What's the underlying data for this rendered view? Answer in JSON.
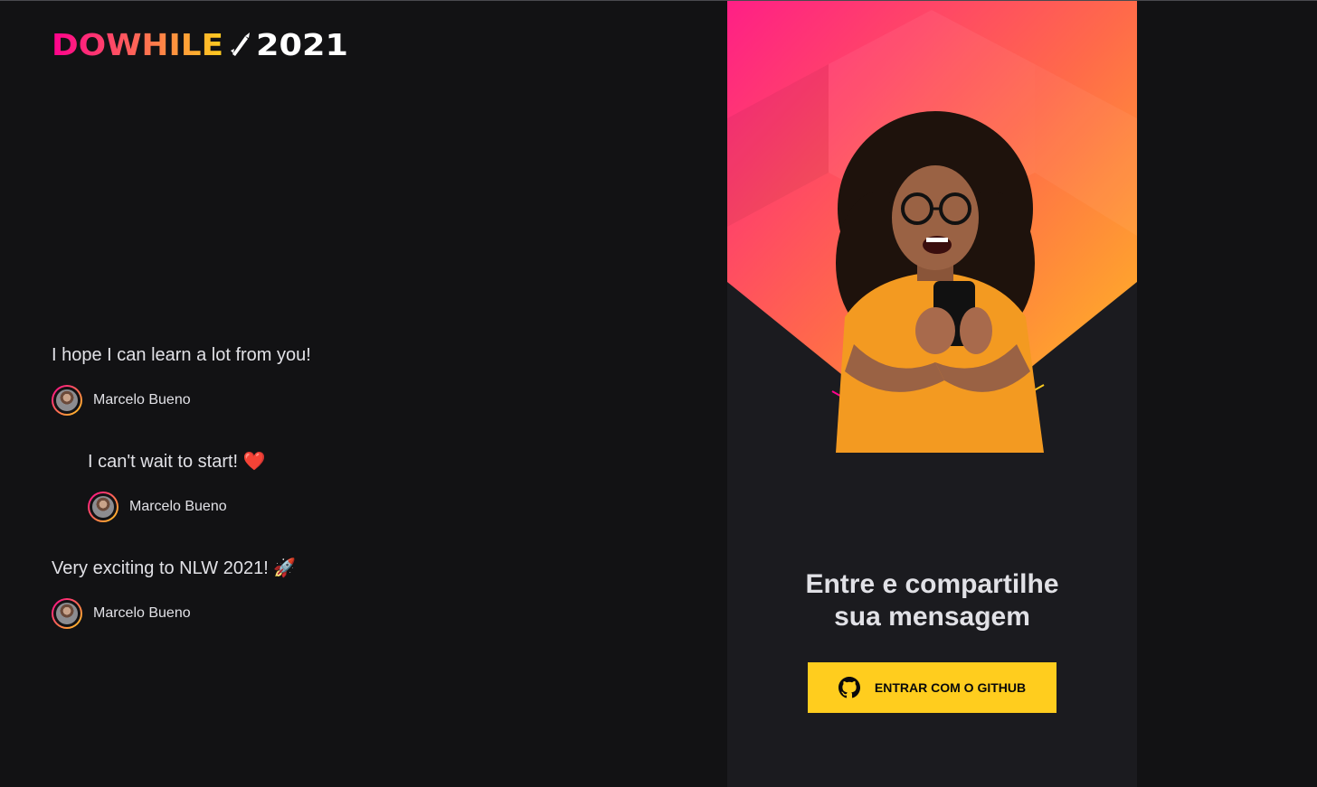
{
  "brand": {
    "logo_word": "DOWHILE",
    "logo_year": "2021"
  },
  "messages": [
    {
      "text": "I hope I can learn a lot from you!",
      "user": "Marcelo Bueno"
    },
    {
      "text": "I can't wait to start! ❤️",
      "user": "Marcelo Bueno"
    },
    {
      "text": "Very exciting to NLW 2021! 🚀",
      "user": "Marcelo Bueno"
    }
  ],
  "login": {
    "title_line1": "Entre e compartilhe",
    "title_line2": "sua mensagem",
    "button_label": "ENTRAR COM O GITHUB",
    "button_icon": "github-icon"
  },
  "colors": {
    "background": "#121214",
    "panel": "#1b1b1f",
    "accent_pink": "#ff008e",
    "accent_yellow": "#ffcd1e",
    "text": "#e1e1e6"
  }
}
